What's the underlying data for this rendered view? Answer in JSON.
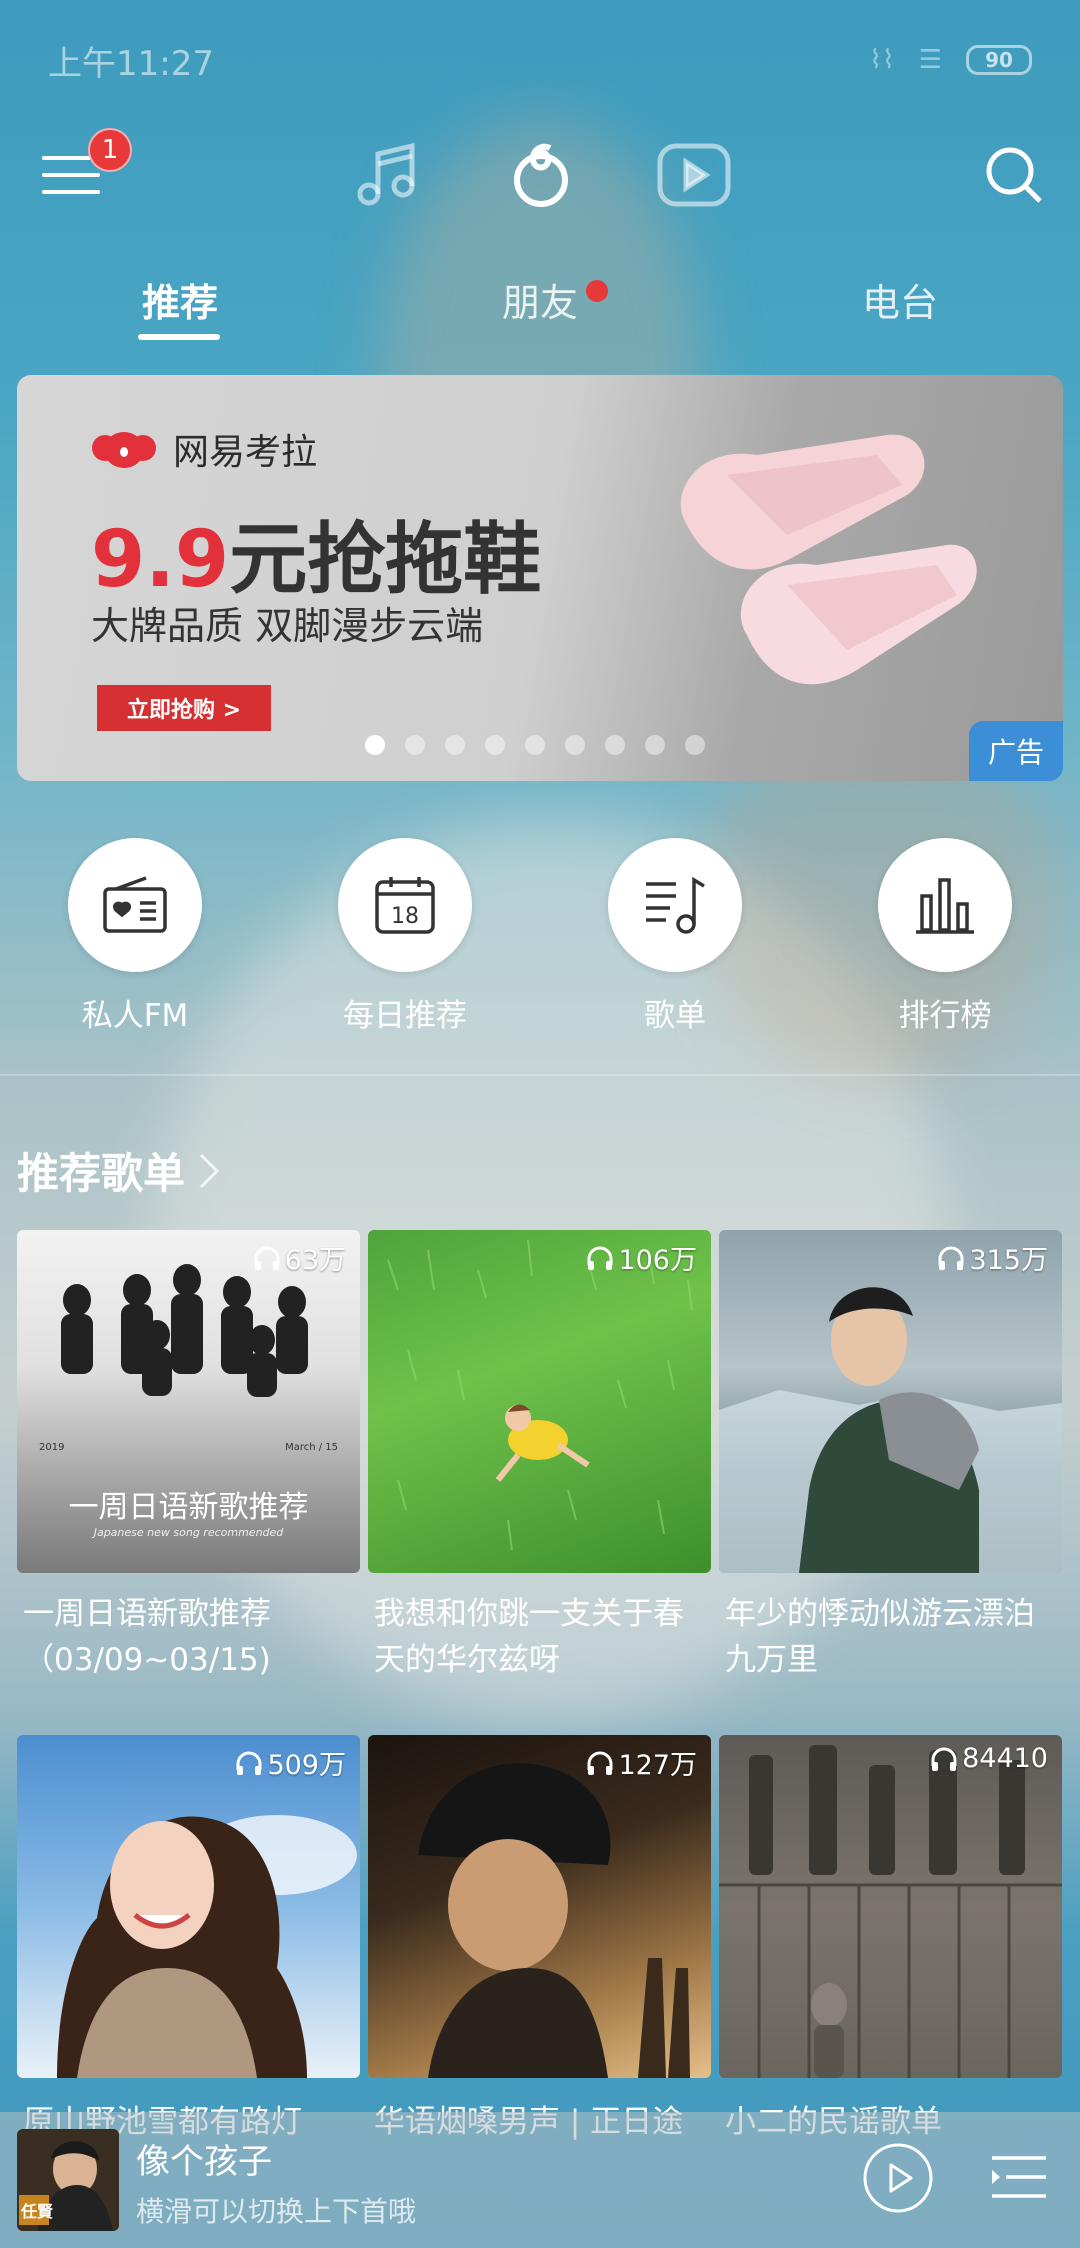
{
  "status": {
    "time": "上午11:27",
    "battery": "90"
  },
  "topnav": {
    "badge": "1"
  },
  "tabs": [
    {
      "label": "推荐"
    },
    {
      "label": "朋友"
    },
    {
      "label": "电台"
    }
  ],
  "banner": {
    "brand": "网易考拉",
    "price": "9.9",
    "headline_rest": "元抢拖鞋",
    "sub": "大牌品质 双脚漫步云端",
    "cta": "立即抢购 >",
    "ad": "广告",
    "dots_total": 9,
    "dots_active": 1
  },
  "quick": [
    {
      "label": "私人FM",
      "icon": "radio-icon"
    },
    {
      "label": "每日推荐",
      "icon": "calendar-icon",
      "day": "18"
    },
    {
      "label": "歌单",
      "icon": "playlist-icon"
    },
    {
      "label": "排行榜",
      "icon": "chart-icon"
    }
  ],
  "section": {
    "title": "推荐歌单"
  },
  "playlists": [
    {
      "plays": "63万",
      "title": "一周日语新歌推荐（03/09~03/15)",
      "cover_text": "一周日语新歌推荐",
      "cover_sub": "Japanese new song recommended",
      "cover_year": "2019",
      "cover_date": "March / 15"
    },
    {
      "plays": "106万",
      "title": "我想和你跳一支关于春天的华尔兹呀"
    },
    {
      "plays": "315万",
      "title": "年少的悸动似游云漂泊九万里"
    },
    {
      "plays": "509万",
      "title": "原山野池雪都有路灯"
    },
    {
      "plays": "127万",
      "title": "华语烟嗓男声 | 正日途"
    },
    {
      "plays": "84410",
      "title": "小二的民谣歌单"
    }
  ],
  "player": {
    "song": "像个孩子",
    "hint": "横滑可以切换上下首哦",
    "album_text": "任賢"
  }
}
